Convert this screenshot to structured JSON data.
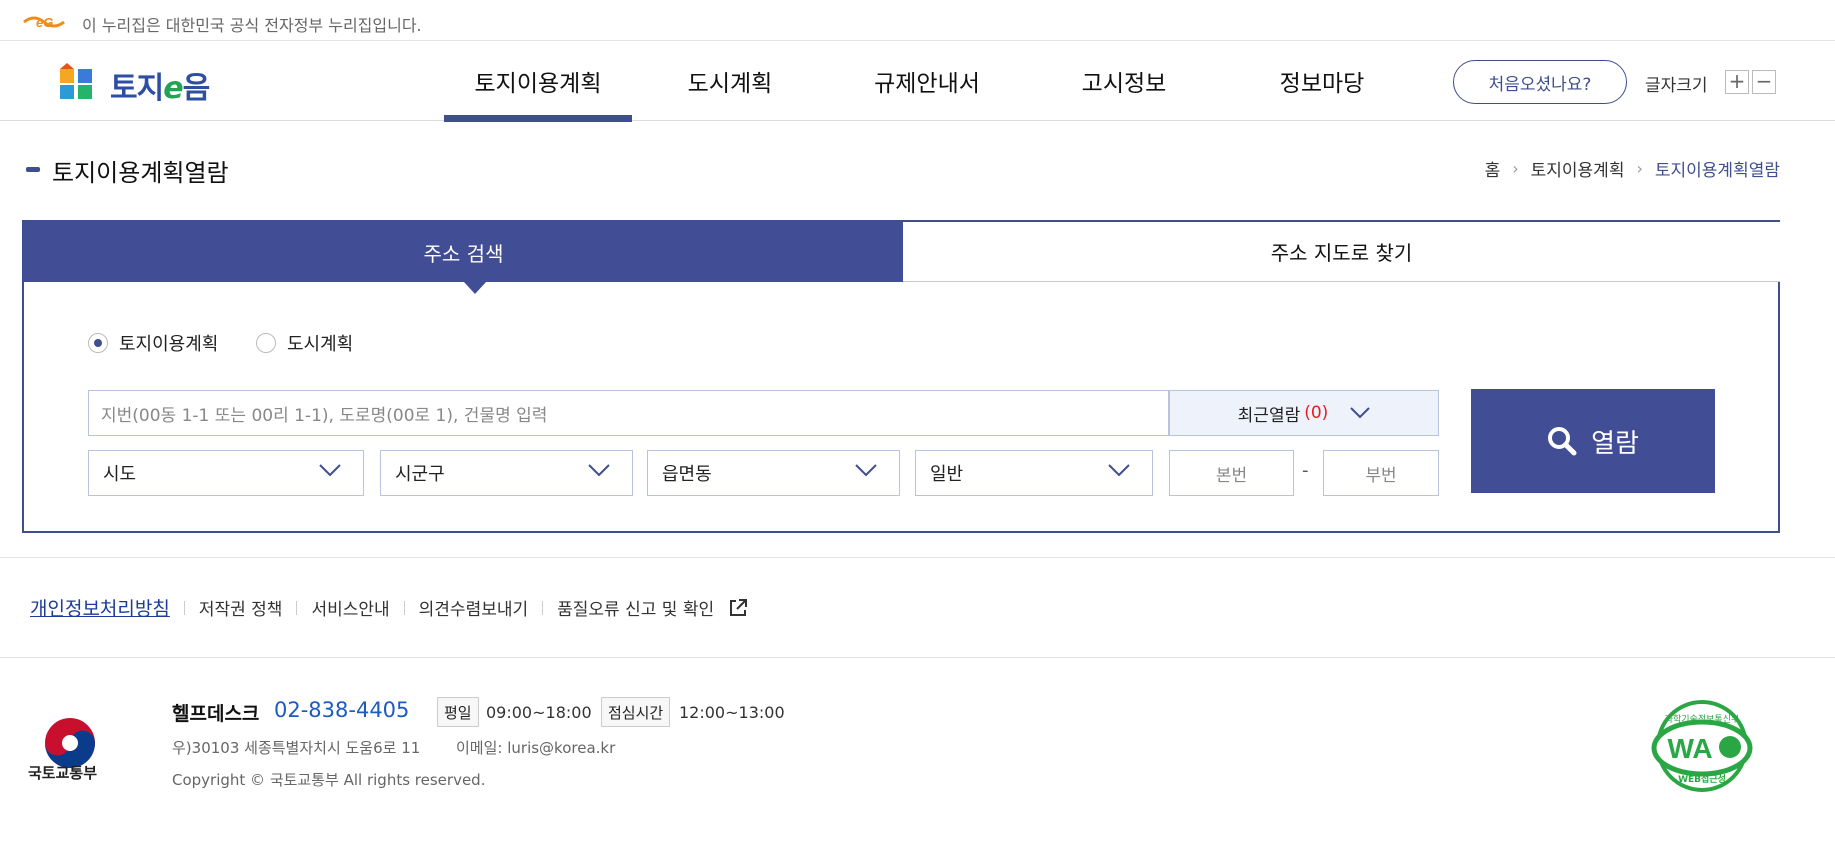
{
  "gov_banner": {
    "text": "이 누리집은 대한민국 공식 전자정부 누리집입니다."
  },
  "header": {
    "logo_text_a": "토지",
    "logo_text_e": "e",
    "logo_text_b": "음",
    "nav": [
      {
        "label": "토지이용계획",
        "active": true
      },
      {
        "label": "도시계획",
        "active": false
      },
      {
        "label": "규제안내서",
        "active": false
      },
      {
        "label": "고시정보",
        "active": false
      },
      {
        "label": "정보마당",
        "active": false
      }
    ],
    "first_visit_label": "처음오셨나요?",
    "font_size_label": "글자크기",
    "font_plus": "+",
    "font_minus": "−"
  },
  "page": {
    "title": "토지이용계획열람",
    "breadcrumb": [
      "홈",
      "토지이용계획",
      "토지이용계획열람"
    ],
    "breadcrumb_sep": "›"
  },
  "search": {
    "tabs": [
      {
        "label": "주소 검색",
        "active": true
      },
      {
        "label": "주소 지도로 찾기",
        "active": false
      }
    ],
    "radios": [
      {
        "label": "토지이용계획",
        "checked": true
      },
      {
        "label": "도시계획",
        "checked": false
      }
    ],
    "address_placeholder": "지번(00동 1-1 또는 00리 1-1), 도로명(00로 1), 건물명 입력",
    "recent_label": "최근열람",
    "recent_count": "(0)",
    "selects": {
      "sido": "시도",
      "sigungu": "시군구",
      "eupmyeondong": "읍면동",
      "land_type": "일반"
    },
    "bonbeon_placeholder": "본번",
    "dash": "-",
    "bubeon_placeholder": "부번",
    "view_button_label": "열람"
  },
  "footer": {
    "links": [
      "개인정보처리방침",
      "저작권 정책",
      "서비스안내",
      "의견수렴보내기",
      "품질오류 신고 및 확인"
    ],
    "ministry_name": "국토교통부",
    "helpdesk_label": "헬프데스크",
    "helpdesk_phone": "02-838-4405",
    "weekday_label": "평일",
    "weekday_time": "09:00~18:00",
    "lunch_label": "점심시간",
    "lunch_time": "12:00~13:00",
    "address": "우)30103 세종특별자치시 도움6로 11",
    "email": "이메일: luris@korea.kr",
    "copyright": "Copyright © 국토교통부 All rights reserved.",
    "wa_mark_text": "WA",
    "wa_mark_top": "과학기술정보통신부",
    "wa_mark_bottom": "WEB접근성"
  },
  "colors": {
    "primary": "#414d95",
    "link_blue": "#1c3b9a",
    "phone_blue": "#1c5bbf",
    "recent_count_red": "#e02020",
    "wa_green": "#2aa744"
  }
}
